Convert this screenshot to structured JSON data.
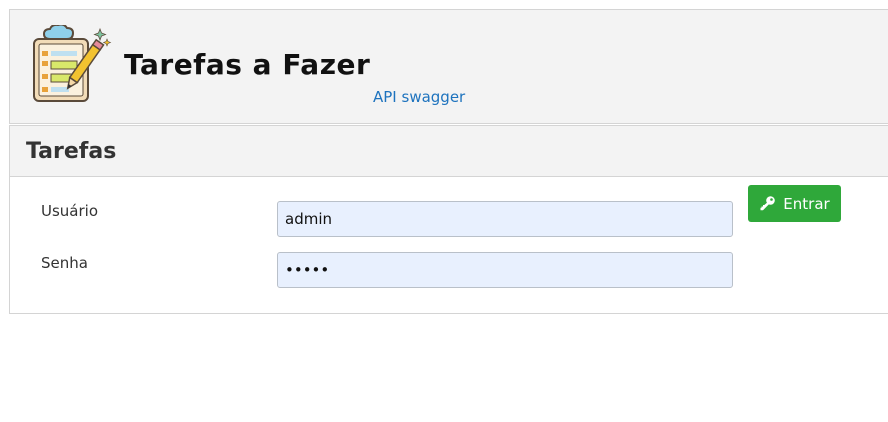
{
  "header": {
    "logo_icon": "clipboard-checklist-pencil-icon",
    "title": "Tarefas a Fazer",
    "api_link": "API swagger"
  },
  "panel": {
    "title": "Tarefas"
  },
  "form": {
    "username_label": "Usuário",
    "username_value": "admin",
    "password_label": "Senha",
    "password_value": "•••••",
    "submit_label": "Entrar",
    "submit_icon": "key-icon"
  },
  "colors": {
    "accent_green": "#2fa83a",
    "link_blue": "#1e73be",
    "input_bg": "#e8f0fe",
    "header_bg": "#f3f3f3"
  }
}
